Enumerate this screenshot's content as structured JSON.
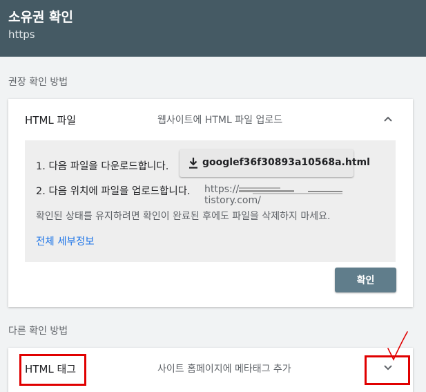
{
  "header": {
    "title": "소유권 확인",
    "subtitle": "https"
  },
  "recommended": {
    "label": "권장 확인 방법",
    "method": {
      "name": "HTML 파일",
      "description": "웹사이트에 HTML 파일 업로드",
      "expanded": true,
      "step1": "1. 다음 파일을 다운로드합니다.",
      "download_file": "googlef36f30893a10568a.html",
      "step2": "2. 다음 위치에 파일을 업로드합니다.",
      "upload_url_prefix": "https://",
      "upload_url_suffix": "tistory.com/",
      "notice": "확인된 상태를 유지하려면 확인이 완료된 후에도 파일을 삭제하지 마세요.",
      "details_link": "전체 세부정보",
      "confirm_button": "확인"
    }
  },
  "other": {
    "label": "다른 확인 방법",
    "method": {
      "name": "HTML 태그",
      "description": "사이트 홈페이지에 메타태그 추가",
      "expanded": false
    }
  },
  "colors": {
    "header_bg": "#455a64",
    "confirm_bg": "#607d8b",
    "link": "#1a73e8",
    "annotation": "#e00000"
  }
}
